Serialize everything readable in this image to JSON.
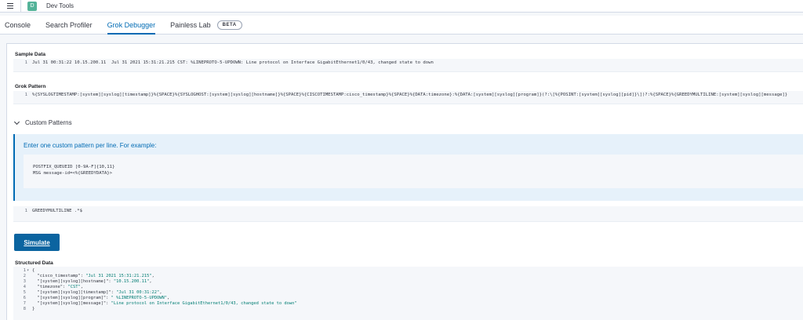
{
  "topbar": {
    "app_badge": "D",
    "title": "Dev Tools"
  },
  "tabs": [
    {
      "label": "Console"
    },
    {
      "label": "Search Profiler"
    },
    {
      "label": "Grok Debugger",
      "active": true
    },
    {
      "label": "Painless Lab",
      "badge": "BETA"
    }
  ],
  "sample_data": {
    "label": "Sample Data",
    "line_number": "1",
    "text": "Jul 31 00:31:22 10.15.200.11  Jul 31 2021 15:31:21.215 CST: %LINEPROTO-5-UPDOWN: Line protocol on Interface GigabitEthernet1/0/43, changed state to down"
  },
  "grok_pattern": {
    "label": "Grok Pattern",
    "line_number": "1",
    "text": "%{SYSLOGTIMESTAMP:[system][syslog][timestamp]}%{SPACE}%{SYSLOGHOST:[system][syslog][hostname]}%{SPACE}%{CISCOTIMESTAMP:cisco_timestamp}%{SPACE}%{DATA:timezone}:%{DATA:[system][syslog][program]}(?:\\[%{POSINT:[system][syslog][pid]}\\])?:%{SPACE}%{GREEDYMULTILINE:[system][syslog][message]}"
  },
  "custom_patterns": {
    "toggle_label": "Custom Patterns",
    "callout_title": "Enter one custom pattern per line. For example:",
    "example_lines": [
      "POSTFIX_QUEUEID [0-9A-F]{10,11}",
      "MSG message-id=<%{GREEDYDATA}>"
    ],
    "editor_line_number": "1",
    "editor_text": "GREEDYMULTILINE .*$"
  },
  "simulate_button": "Simulate",
  "structured_data": {
    "label": "Structured Data",
    "lines": [
      {
        "n": "1",
        "fold": "▾",
        "parts": [
          [
            "p",
            "{"
          ]
        ]
      },
      {
        "n": "2",
        "parts": [
          [
            "p",
            "  "
          ],
          [
            "k",
            "\"cisco_timestamp\""
          ],
          [
            "p",
            ": "
          ],
          [
            "s",
            "\"Jul 31 2021 15:31:21.215\""
          ],
          [
            "p",
            ","
          ]
        ]
      },
      {
        "n": "3",
        "parts": [
          [
            "p",
            "  "
          ],
          [
            "k",
            "\"[system][syslog][hostname]\""
          ],
          [
            "p",
            ": "
          ],
          [
            "s",
            "\"10.15.200.11\""
          ],
          [
            "p",
            ","
          ]
        ]
      },
      {
        "n": "4",
        "parts": [
          [
            "p",
            "  "
          ],
          [
            "k",
            "\"timezone\""
          ],
          [
            "p",
            ": "
          ],
          [
            "s",
            "\"CST\""
          ],
          [
            "p",
            ","
          ]
        ]
      },
      {
        "n": "5",
        "parts": [
          [
            "p",
            "  "
          ],
          [
            "k",
            "\"[system][syslog][timestamp]\""
          ],
          [
            "p",
            ": "
          ],
          [
            "s",
            "\"Jul 31 00:31:22\""
          ],
          [
            "p",
            ","
          ]
        ]
      },
      {
        "n": "6",
        "parts": [
          [
            "p",
            "  "
          ],
          [
            "k",
            "\"[system][syslog][program]\""
          ],
          [
            "p",
            ": "
          ],
          [
            "s",
            "\" %LINEPROTO-5-UPDOWN\""
          ],
          [
            "p",
            ","
          ]
        ]
      },
      {
        "n": "7",
        "parts": [
          [
            "p",
            "  "
          ],
          [
            "k",
            "\"[system][syslog][message]\""
          ],
          [
            "p",
            ": "
          ],
          [
            "s",
            "\"Line protocol on Interface GigabitEthernet1/0/43, changed state to down\""
          ]
        ]
      },
      {
        "n": "8",
        "parts": [
          [
            "p",
            "}"
          ]
        ]
      }
    ]
  },
  "colors": {
    "accent": "#006bb4",
    "button": "#0b64a0",
    "json_string": "#017d73",
    "app_badge": "#54b399"
  }
}
